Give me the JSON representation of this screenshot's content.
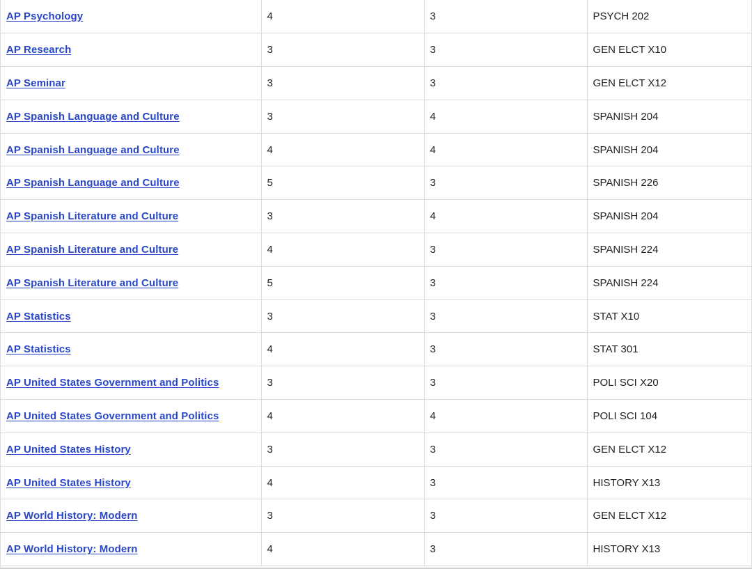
{
  "table": {
    "rows": [
      {
        "course": "AP Psychology",
        "score": "4",
        "credits": "3",
        "equivalent": "PSYCH 202"
      },
      {
        "course": "AP Research",
        "score": "3",
        "credits": "3",
        "equivalent": "GEN ELCT X10"
      },
      {
        "course": "AP Seminar",
        "score": "3",
        "credits": "3",
        "equivalent": "GEN ELCT X12"
      },
      {
        "course": "AP Spanish Language and Culture",
        "score": "3",
        "credits": "4",
        "equivalent": "SPANISH 204"
      },
      {
        "course": "AP Spanish Language and Culture",
        "score": "4",
        "credits": "4",
        "equivalent": "SPANISH 204"
      },
      {
        "course": "AP Spanish Language and Culture",
        "score": "5",
        "credits": "3",
        "equivalent": "SPANISH 226"
      },
      {
        "course": "AP Spanish Literature and Culture",
        "score": "3",
        "credits": "4",
        "equivalent": "SPANISH 204"
      },
      {
        "course": "AP Spanish Literature and Culture",
        "score": "4",
        "credits": "3",
        "equivalent": "SPANISH 224"
      },
      {
        "course": "AP Spanish Literature and Culture",
        "score": "5",
        "credits": "3",
        "equivalent": "SPANISH 224"
      },
      {
        "course": "AP Statistics",
        "score": "3",
        "credits": "3",
        "equivalent": "STAT X10"
      },
      {
        "course": "AP Statistics",
        "score": "4",
        "credits": "3",
        "equivalent": "STAT 301"
      },
      {
        "course": "AP United States Government and Politics",
        "score": "3",
        "credits": "3",
        "equivalent": "POLI SCI X20"
      },
      {
        "course": "AP United States Government and Politics",
        "score": "4",
        "credits": "4",
        "equivalent": "POLI SCI 104"
      },
      {
        "course": "AP United States History",
        "score": "3",
        "credits": "3",
        "equivalent": "GEN ELCT X12"
      },
      {
        "course": "AP United States History",
        "score": "4",
        "credits": "3",
        "equivalent": "HISTORY X13"
      },
      {
        "course": "AP World History: Modern",
        "score": "3",
        "credits": "3",
        "equivalent": "GEN ELCT X12"
      },
      {
        "course": "AP World History: Modern",
        "score": "4",
        "credits": "3",
        "equivalent": "HISTORY X13"
      }
    ]
  },
  "colors": {
    "link": "#2a47c9",
    "text": "#222222",
    "border": "#dcdcdc"
  }
}
